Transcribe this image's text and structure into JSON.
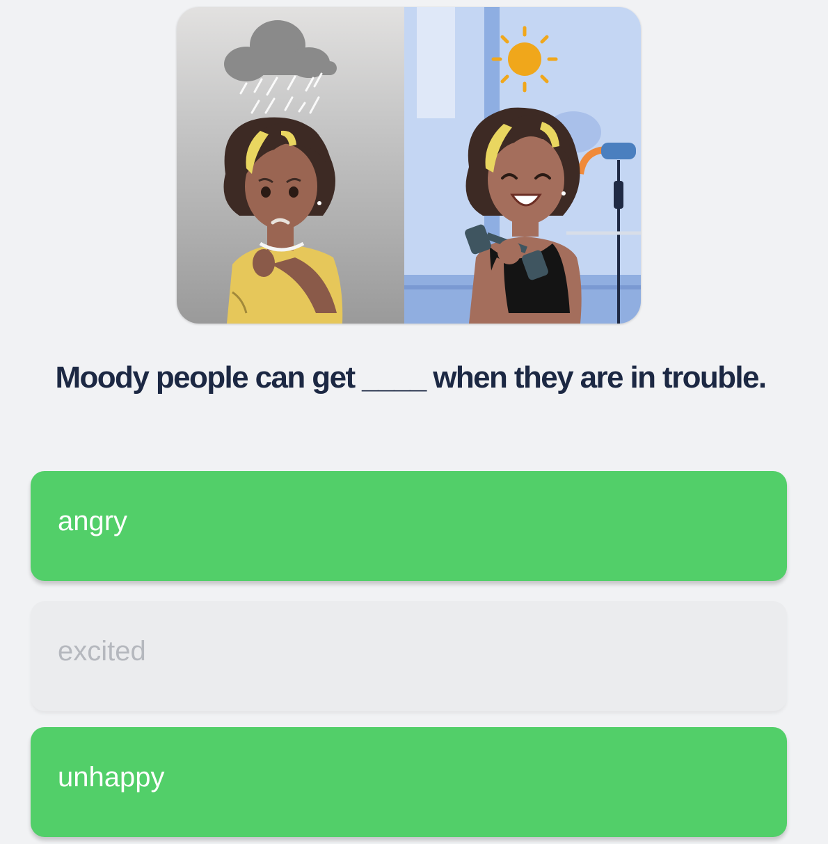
{
  "illustration": {
    "left_scene": "sad-girl-in-rain",
    "right_scene": "happy-girl-with-dumbbell",
    "colors": {
      "gray_bg": "#b5b5b5",
      "blue_bg": "#c4d6f3",
      "cloud": "#8a8a8a",
      "sun": "#f0a71b",
      "hair": "#3d2a24",
      "hair_highlight": "#e9d660",
      "skin": "#a46e5c",
      "shirt": "#e6c75a",
      "tank_top": "#141414",
      "dumbbell": "#3f5560"
    }
  },
  "question": {
    "before": "Moody people can get",
    "blank": "____",
    "after": "when they are in trouble."
  },
  "options": [
    {
      "label": "angry",
      "state": "correct"
    },
    {
      "label": "excited",
      "state": "disabled"
    },
    {
      "label": "unhappy",
      "state": "correct"
    }
  ],
  "colors": {
    "background": "#f1f2f4",
    "question_text": "#1c2843",
    "option_correct": "#52cf69",
    "option_disabled": "#ebecee",
    "option_disabled_text": "#b5b8be"
  }
}
